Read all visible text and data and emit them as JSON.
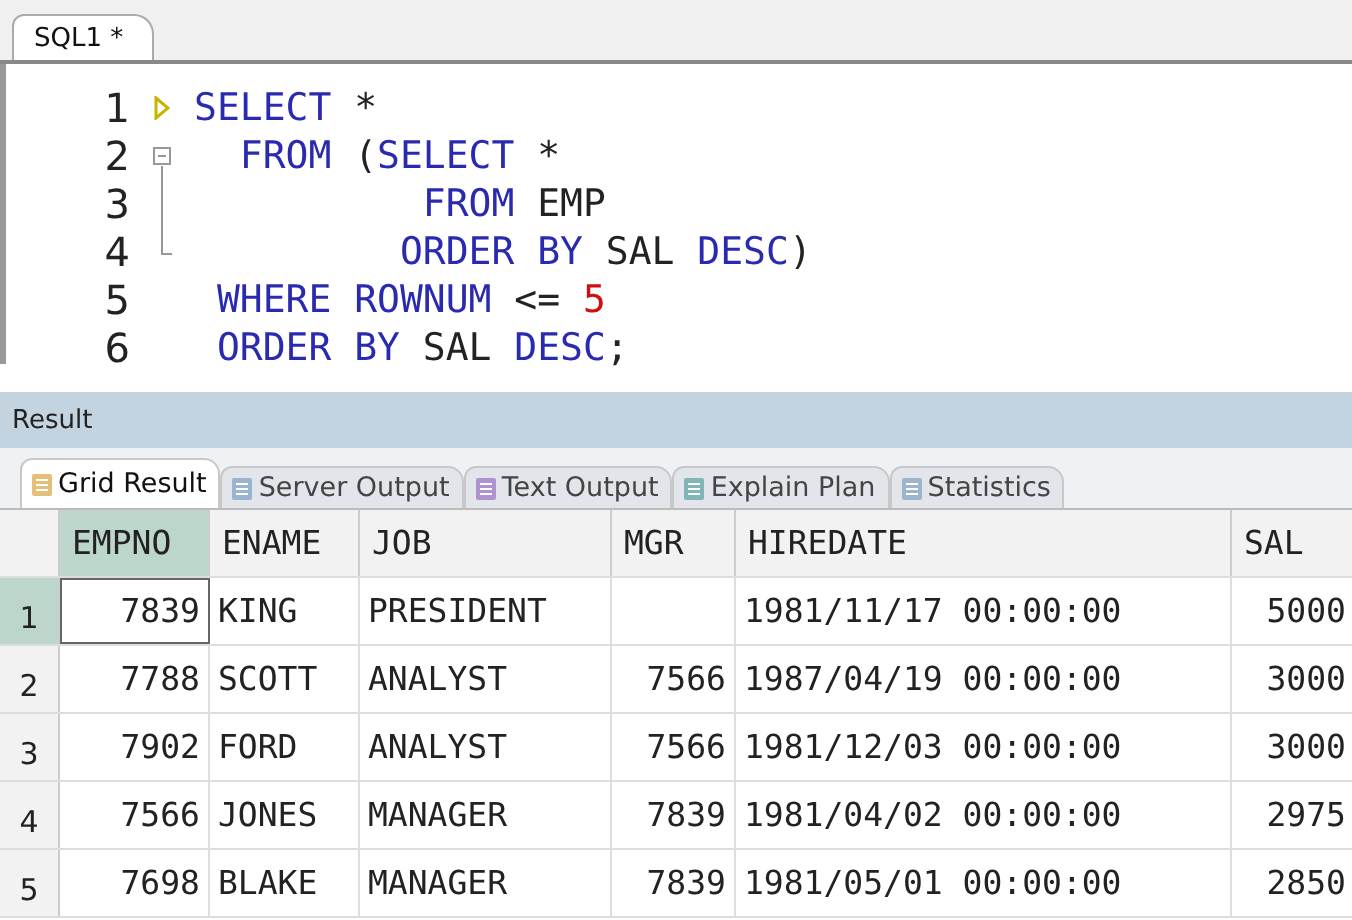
{
  "editor_tabs": [
    {
      "label": "SQL1 *",
      "selected": true
    }
  ],
  "editor": {
    "lines": [
      {
        "number": "1",
        "kind": "run",
        "tokens": [
          {
            "text": "SELECT",
            "kind": "keyword"
          },
          {
            "text": " *",
            "kind": "plain"
          }
        ]
      },
      {
        "number": "2",
        "kind": "fold",
        "tokens": [
          {
            "text": "  FROM ",
            "kind": "keyword"
          },
          {
            "text": "(",
            "kind": "plain"
          },
          {
            "text": "SELECT",
            "kind": "keyword"
          },
          {
            "text": " *",
            "kind": "plain"
          }
        ]
      },
      {
        "number": "3",
        "kind": "fold-line",
        "tokens": [
          {
            "text": "          FROM ",
            "kind": "keyword"
          },
          {
            "text": "EMP",
            "kind": "plain"
          }
        ]
      },
      {
        "number": "4",
        "kind": "fold-end",
        "tokens": [
          {
            "text": "         ORDER BY ",
            "kind": "keyword"
          },
          {
            "text": "SAL ",
            "kind": "plain"
          },
          {
            "text": "DESC",
            "kind": "keyword"
          },
          {
            "text": ")",
            "kind": "plain"
          }
        ]
      },
      {
        "number": "5",
        "kind": "plain",
        "tokens": [
          {
            "text": " WHERE ROWNUM ",
            "kind": "keyword"
          },
          {
            "text": "<= ",
            "kind": "plain"
          },
          {
            "text": "5",
            "kind": "number"
          }
        ]
      },
      {
        "number": "6",
        "kind": "plain",
        "tokens": [
          {
            "text": " ORDER BY ",
            "kind": "keyword"
          },
          {
            "text": "SAL ",
            "kind": "plain"
          },
          {
            "text": "DESC",
            "kind": "keyword"
          },
          {
            "text": ";",
            "kind": "plain"
          }
        ]
      }
    ]
  },
  "result": {
    "title": "Result",
    "tabs": [
      {
        "label": "Grid Result",
        "selected": true
      },
      {
        "label": "Server Output",
        "selected": false
      },
      {
        "label": "Text Output",
        "selected": false
      },
      {
        "label": "Explain Plan",
        "selected": false
      },
      {
        "label": "Statistics",
        "selected": false
      }
    ],
    "columns": [
      {
        "name": "EMPNO",
        "selected": true,
        "kind": "number"
      },
      {
        "name": "ENAME",
        "selected": false,
        "kind": "text"
      },
      {
        "name": "JOB",
        "selected": false,
        "kind": "text"
      },
      {
        "name": "MGR",
        "selected": false,
        "kind": "number"
      },
      {
        "name": "HIREDATE",
        "selected": false,
        "kind": "text"
      },
      {
        "name": "SAL",
        "selected": false,
        "kind": "number"
      }
    ],
    "rows": [
      {
        "number": "1",
        "selected": true,
        "cells": [
          "7839",
          "KING",
          "PRESIDENT",
          "",
          "1981/11/17 00:00:00",
          "5000"
        ]
      },
      {
        "number": "2",
        "selected": false,
        "cells": [
          "7788",
          "SCOTT",
          "ANALYST",
          "7566",
          "1987/04/19 00:00:00",
          "3000"
        ]
      },
      {
        "number": "3",
        "selected": false,
        "cells": [
          "7902",
          "FORD",
          "ANALYST",
          "7566",
          "1981/12/03 00:00:00",
          "3000"
        ]
      },
      {
        "number": "4",
        "selected": false,
        "cells": [
          "7566",
          "JONES",
          "MANAGER",
          "7839",
          "1981/04/02 00:00:00",
          "2975"
        ]
      },
      {
        "number": "5",
        "selected": false,
        "cells": [
          "7698",
          "BLAKE",
          "MANAGER",
          "7839",
          "1981/05/01 00:00:00",
          "2850"
        ]
      }
    ]
  }
}
